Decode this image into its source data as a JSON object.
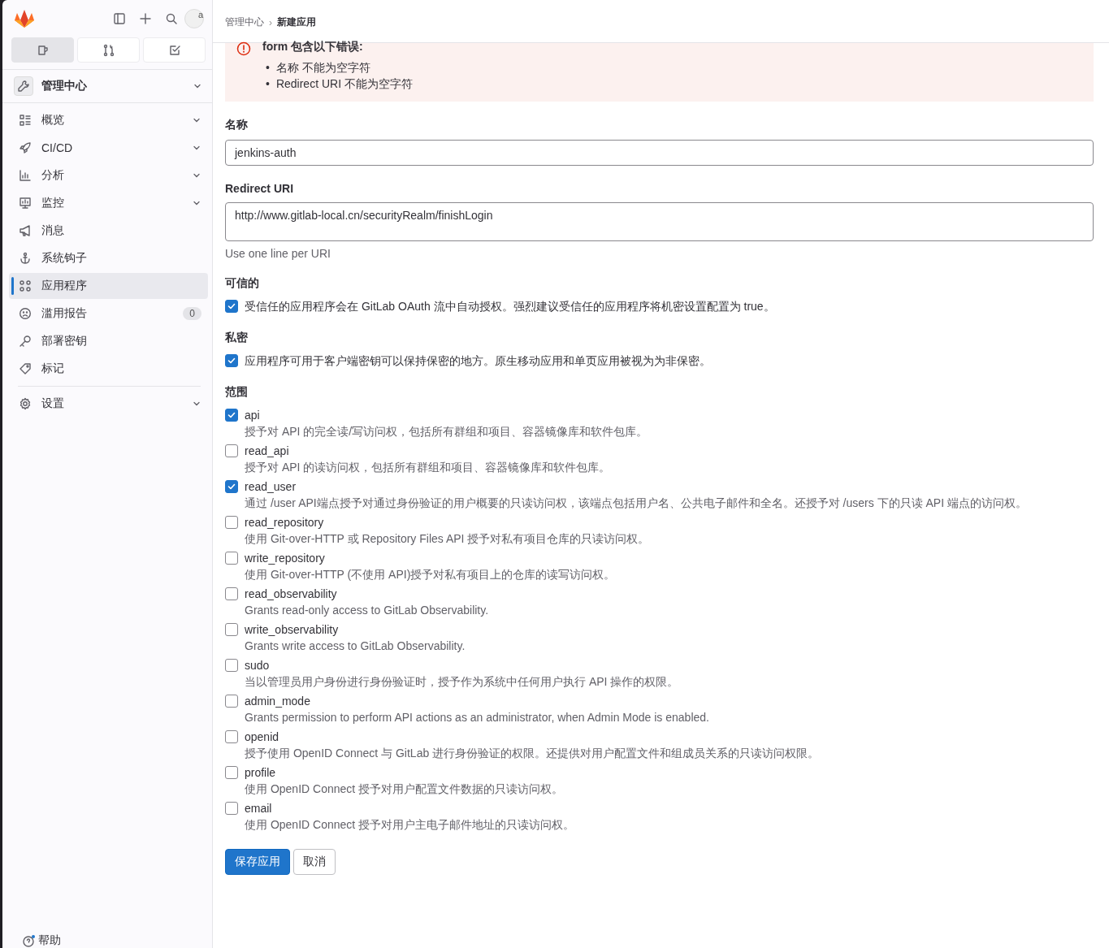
{
  "sidebar": {
    "avatar_text": "a",
    "tabs": [
      {
        "kind": "issues",
        "selected": true
      },
      {
        "kind": "merge",
        "selected": false
      },
      {
        "kind": "todo",
        "selected": false
      }
    ],
    "section": {
      "label": "管理中心",
      "expanded": false
    },
    "items": [
      {
        "label": "概览",
        "expandable": true,
        "selected": false
      },
      {
        "label": "CI/CD",
        "expandable": true,
        "selected": false
      },
      {
        "label": "分析",
        "expandable": true,
        "selected": false
      },
      {
        "label": "监控",
        "expandable": true,
        "selected": false
      },
      {
        "label": "消息",
        "expandable": false,
        "selected": false
      },
      {
        "label": "系统钩子",
        "expandable": false,
        "selected": false
      },
      {
        "label": "应用程序",
        "expandable": false,
        "selected": true
      },
      {
        "label": "滥用报告",
        "expandable": false,
        "selected": false,
        "badge": "0"
      },
      {
        "label": "部署密钥",
        "expandable": false,
        "selected": false
      },
      {
        "label": "标记",
        "expandable": false,
        "selected": false
      }
    ],
    "settings": {
      "label": "设置",
      "expandable": true
    },
    "help": {
      "label": "帮助"
    }
  },
  "breadcrumb": {
    "separator": "›",
    "items": [
      {
        "label": "管理中心",
        "current": false
      },
      {
        "label": "新建应用",
        "current": true
      }
    ]
  },
  "alert": {
    "title": "form 包含以下错误:",
    "bullet": "•",
    "errors": [
      "名称 不能为空字符",
      "Redirect URI 不能为空字符"
    ]
  },
  "form": {
    "name": {
      "label": "名称",
      "value": "jenkins-auth"
    },
    "redirect": {
      "label": "Redirect URI",
      "value": "http://www.gitlab-local.cn/securityRealm/finishLogin",
      "help": "Use one line per URI"
    },
    "trusted": {
      "label": "可信的",
      "checked": true,
      "text": "受信任的应用程序会在 GitLab OAuth 流中自动授权。强烈建议受信任的应用程序将机密设置配置为 true。"
    },
    "confidential": {
      "label": "私密",
      "checked": true,
      "text": "应用程序可用于客户端密钥可以保持保密的地方。原生移动应用和单页应用被视为为非保密。"
    },
    "scopes_label": "范围",
    "scopes": [
      {
        "name": "api",
        "checked": true,
        "description": "授予对 API 的完全读/写访问权，包括所有群组和项目、容器镜像库和软件包库。"
      },
      {
        "name": "read_api",
        "checked": false,
        "description": "授予对 API 的读访问权，包括所有群组和项目、容器镜像库和软件包库。"
      },
      {
        "name": "read_user",
        "checked": true,
        "description": "通过 /user API端点授予对通过身份验证的用户概要的只读访问权，该端点包括用户名、公共电子邮件和全名。还授予对 /users 下的只读 API 端点的访问权。"
      },
      {
        "name": "read_repository",
        "checked": false,
        "description": "使用 Git-over-HTTP 或 Repository Files API 授予对私有项目仓库的只读访问权。"
      },
      {
        "name": "write_repository",
        "checked": false,
        "description": "使用 Git-over-HTTP (不使用 API)授予对私有项目上的仓库的读写访问权。"
      },
      {
        "name": "read_observability",
        "checked": false,
        "description": "Grants read-only access to GitLab Observability."
      },
      {
        "name": "write_observability",
        "checked": false,
        "description": "Grants write access to GitLab Observability."
      },
      {
        "name": "sudo",
        "checked": false,
        "description": "当以管理员用户身份进行身份验证时，授予作为系统中任何用户执行 API 操作的权限。"
      },
      {
        "name": "admin_mode",
        "checked": false,
        "description": "Grants permission to perform API actions as an administrator, when Admin Mode is enabled."
      },
      {
        "name": "openid",
        "checked": false,
        "description": "授予使用 OpenID Connect 与 GitLab 进行身份验证的权限。还提供对用户配置文件和组成员关系的只读访问权限。"
      },
      {
        "name": "profile",
        "checked": false,
        "description": "使用 OpenID Connect 授予对用户配置文件数据的只读访问权。"
      },
      {
        "name": "email",
        "checked": false,
        "description": "使用 OpenID Connect 授予对用户主电子邮件地址的只读访问权。"
      }
    ],
    "buttons": [
      {
        "label": "保存应用",
        "kind": "primary"
      },
      {
        "label": "取消",
        "kind": "default"
      }
    ]
  }
}
